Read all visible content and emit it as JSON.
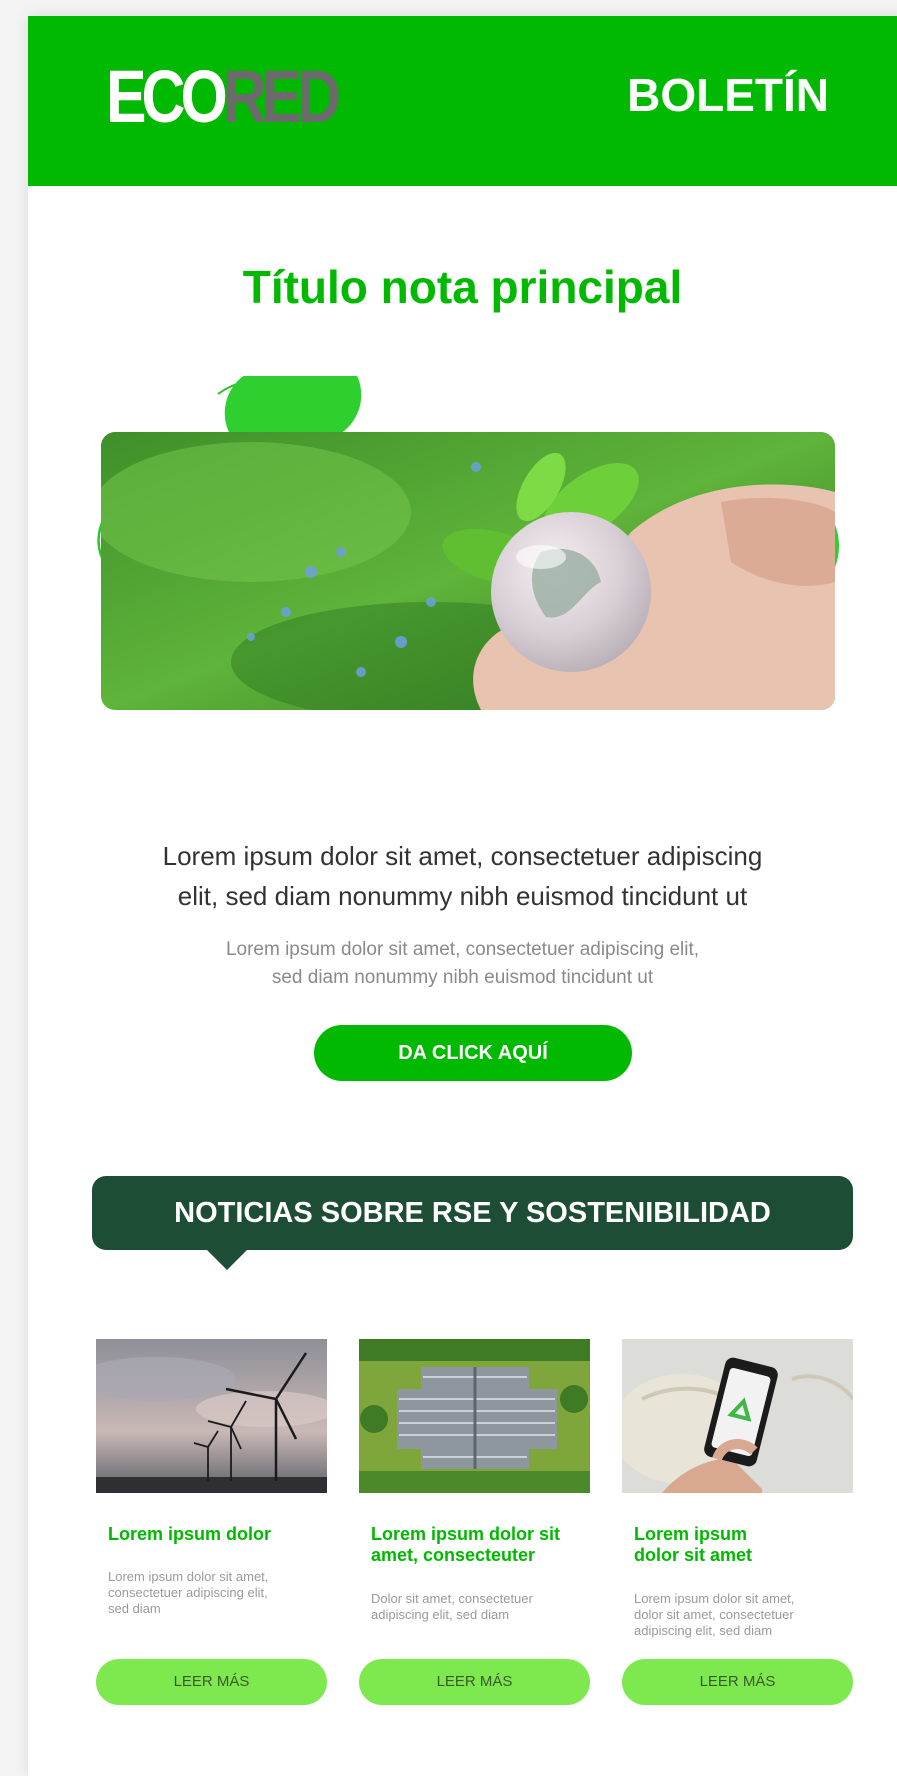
{
  "header": {
    "logo_eco": "ECO",
    "logo_red": "RED",
    "title": "BOLETÍN"
  },
  "main": {
    "title": "Título nota principal",
    "lead_line1": "Lorem ipsum dolor sit amet, consectetuer adipiscing",
    "lead_line2": "elit, sed diam nonummy nibh euismod tincidunt ut",
    "sub_line1": "Lorem ipsum dolor sit amet, consectetuer adipiscing elit,",
    "sub_line2": "sed diam nonummy nibh euismod tincidunt ut",
    "cta_label": "DA CLICK AQUÍ"
  },
  "section": {
    "title": "NOTICIAS SOBRE RSE Y SOSTENIBILIDAD"
  },
  "news": [
    {
      "title_line1": "Lorem ipsum dolor",
      "title_line2": "",
      "text_line1": "Lorem ipsum dolor sit amet,",
      "text_line2": "consectetuer adipiscing elit,",
      "text_line3": "sed diam",
      "button": "LEER MÁS"
    },
    {
      "title_line1": "Lorem ipsum dolor sit",
      "title_line2": "amet, consecteuter",
      "text_line1": "Dolor sit amet, consectetuer",
      "text_line2": "adipiscing elit, sed diam",
      "text_line3": "",
      "button": "LEER MÁS"
    },
    {
      "title_line1": "Lorem ipsum",
      "title_line2": "dolor sit amet",
      "text_line1": "Lorem ipsum dolor sit amet,",
      "text_line2": "dolor sit amet, consectetuer",
      "text_line3": "adipiscing elit, sed diam",
      "button": "LEER MÁS"
    }
  ],
  "colors": {
    "brand_green": "#00b900",
    "dark_green": "#1d4d34",
    "light_green": "#7ee84f",
    "logo_gray": "#6b6b6b"
  }
}
